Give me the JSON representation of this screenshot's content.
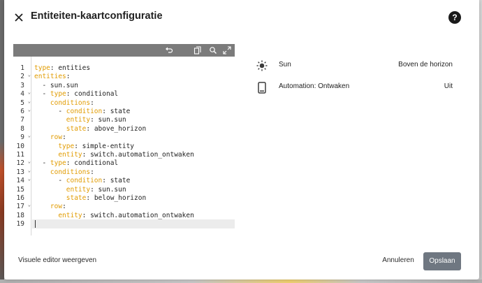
{
  "dialog": {
    "title": "Entiteiten-kaartconfiguratie",
    "help_label": "?"
  },
  "editor": {
    "toolbar_icons": [
      "undo-icon",
      "copy-icon",
      "search-replace-icon",
      "fullscreen-icon"
    ],
    "line_numbers": [
      "1",
      "2",
      "3",
      "4",
      "5",
      "6",
      "7",
      "8",
      "9",
      "10",
      "11",
      "12",
      "13",
      "14",
      "15",
      "16",
      "17",
      "18",
      "19"
    ],
    "fold_marks": [
      "",
      "⌄",
      "",
      "⌄",
      "⌄",
      "⌄",
      "",
      "",
      "⌄",
      "",
      "",
      "⌄",
      "⌄",
      "⌄",
      "",
      "",
      "⌄",
      "",
      ""
    ],
    "lines": [
      [
        [
          "k",
          "type"
        ],
        [
          "t",
          ": entities"
        ]
      ],
      [
        [
          "k",
          "entities"
        ],
        [
          "t",
          ":"
        ]
      ],
      [
        [
          "t",
          "  - sun.sun"
        ]
      ],
      [
        [
          "t",
          "  - "
        ],
        [
          "k",
          "type"
        ],
        [
          "t",
          ": conditional"
        ]
      ],
      [
        [
          "t",
          "    "
        ],
        [
          "k",
          "conditions"
        ],
        [
          "t",
          ":"
        ]
      ],
      [
        [
          "t",
          "      - "
        ],
        [
          "k",
          "condition"
        ],
        [
          "t",
          ": state"
        ]
      ],
      [
        [
          "t",
          "        "
        ],
        [
          "k",
          "entity"
        ],
        [
          "t",
          ": sun.sun"
        ]
      ],
      [
        [
          "t",
          "        "
        ],
        [
          "k",
          "state"
        ],
        [
          "t",
          ": above_horizon"
        ]
      ],
      [
        [
          "t",
          "    "
        ],
        [
          "k",
          "row"
        ],
        [
          "t",
          ":"
        ]
      ],
      [
        [
          "t",
          "      "
        ],
        [
          "k",
          "type"
        ],
        [
          "t",
          ": simple-entity"
        ]
      ],
      [
        [
          "t",
          "      "
        ],
        [
          "k",
          "entity"
        ],
        [
          "t",
          ": switch.automation_ontwaken"
        ]
      ],
      [
        [
          "t",
          "  - "
        ],
        [
          "k",
          "type"
        ],
        [
          "t",
          ": conditional"
        ]
      ],
      [
        [
          "t",
          "    "
        ],
        [
          "k",
          "conditions"
        ],
        [
          "t",
          ":"
        ]
      ],
      [
        [
          "t",
          "      - "
        ],
        [
          "k",
          "condition"
        ],
        [
          "t",
          ": state"
        ]
      ],
      [
        [
          "t",
          "        "
        ],
        [
          "k",
          "entity"
        ],
        [
          "t",
          ": sun.sun"
        ]
      ],
      [
        [
          "t",
          "        "
        ],
        [
          "k",
          "state"
        ],
        [
          "t",
          ": below_horizon"
        ]
      ],
      [
        [
          "t",
          "    "
        ],
        [
          "k",
          "row"
        ],
        [
          "t",
          ":"
        ]
      ],
      [
        [
          "t",
          "      "
        ],
        [
          "k",
          "entity"
        ],
        [
          "t",
          ": switch.automation_ontwaken"
        ]
      ],
      [
        [
          "t",
          ""
        ]
      ]
    ],
    "active_line_index": 18
  },
  "preview": {
    "rows": [
      {
        "icon": "sun-icon",
        "name": "Sun",
        "state": "Boven de horizon"
      },
      {
        "icon": "tablet-icon",
        "name": "Automation: Ontwaken",
        "state": "Uit"
      }
    ]
  },
  "footer": {
    "visual_editor_label": "Visuele editor weergeven",
    "cancel_label": "Annuleren",
    "save_label": "Opslaan"
  },
  "colors": {
    "accent_key": "#e19b00",
    "toolbar": "#7b7b7b",
    "save_button": "#6f7781"
  }
}
